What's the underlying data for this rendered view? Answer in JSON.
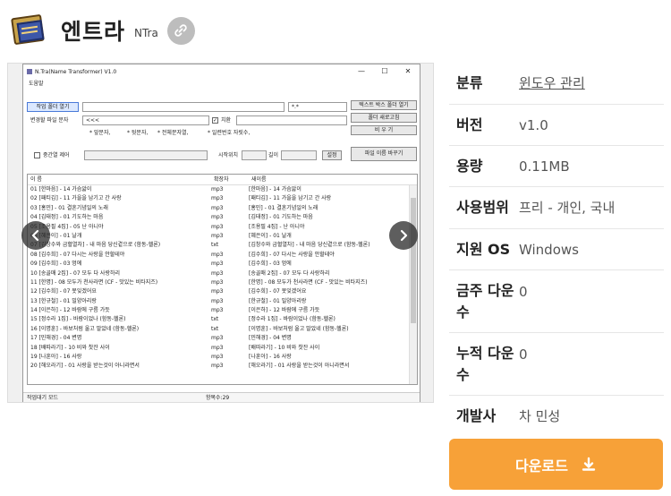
{
  "header": {
    "title": "엔트라",
    "subtitle": "NTra"
  },
  "screenshot": {
    "window_title": "N.Tra(Name Transformer) V1.0",
    "menu": "도움말",
    "buttons": {
      "open_folder": "작업 폴더 열기",
      "text_box_folder": "텍스트 박스 폴더 열기",
      "refresh_folder": "폴더 새로고침",
      "clear": "비 우 기",
      "rename": "파일 이름 바꾸기",
      "apply": "설정"
    },
    "filter_value": "*.*",
    "replace_label": "변경할 파일 문자",
    "replace_value": "<<<",
    "replace_check": "치환",
    "hints": {
      "h1": "* 앞문자,",
      "h2": "* 뒷문자,",
      "h3": "* 전체문자열,",
      "h4": "* 일련번호 자릿수,"
    },
    "middle_check": "중간열 제어",
    "start_pos": "시작위치",
    "length": "길이",
    "columns": [
      "이 름",
      "확장자",
      "새이름"
    ],
    "rows": [
      [
        "01 [한마음] - 14 가슴앓이",
        "mp3",
        "[한마음] - 14 가슴앓이"
      ],
      [
        "02 [패티김] - 11 가을을 남기고 간 사랑",
        "mp3",
        "[패티김] - 11 가을을 남기고 간 사랑"
      ],
      [
        "03 [홍민] - 01 결혼기념일의 노래",
        "mp3",
        "[홍민] - 01 결혼기념일의 노래"
      ],
      [
        "04 [김태정] - 01 기도하는 마음",
        "mp3",
        "[김태정] - 01 기도하는 마음"
      ],
      [
        "05 [조용필 4집] - 05 난 아니야",
        "mp3",
        "[조용필 4집] - 난 아니야"
      ],
      [
        "06 [혜은이] - 01 날개",
        "mp3",
        "[혜은이] - 01 날개"
      ],
      [
        "07 [김창수와 금혈열차] - 내 마음 당신곁으로 (함동-헬론)",
        "txt",
        "[김창수와 금혈열차] - 내 마음 당신곁으로 (함동-헬론)"
      ],
      [
        "08 [김수희] - 07 다시는 사랑을 안할테야",
        "mp3",
        "[김수희] - 07 다시는 사랑을 안할테야"
      ],
      [
        "09 [김수희] - 03 멍에",
        "mp3",
        "[김수희] - 03 멍에"
      ],
      [
        "10 [송골매 2집] - 07 모두 다 사랑하리",
        "mp3",
        "[송골매 2집] - 07 모두 다 사랑하리"
      ],
      [
        "11 [한명] - 08 모두가 천사라면 (CF - 맛있는 비타지즈)",
        "mp3",
        "[한명] - 08 모두가 천사라면 (CF - 맛있는 비타지즈)"
      ],
      [
        "12 [김수희] - 07 못잊겠어요",
        "mp3",
        "[김수희] - 07 못잊겠어요"
      ],
      [
        "13 [한규철] - 01 밀양아리랑",
        "mp3",
        "[한규철] - 01 밀양아리랑"
      ],
      [
        "14 [이은하] - 12 바람에 구름 가듯",
        "mp3",
        "[이은하] - 12 바람에 구름 가듯"
      ],
      [
        "15 [정수라 1집] - 바람이었나 (함동-헬론)",
        "txt",
        "[정수라 1집] - 바람이었나 (함동-헬론)"
      ],
      [
        "16 [이명훈] - 바보처럼 울고 말았네 (함동-헬론)",
        "txt",
        "[이명훈] - 바보처럼 울고 말았네 (함동-헬론)"
      ],
      [
        "17 [민해경] - 04 변명",
        "mp3",
        "[민해경] - 04 변명"
      ],
      [
        "18 [배따라기] - 10 비와 찻잔 사이",
        "mp3",
        "[배따라기] - 10 비와 찻잔 사이"
      ],
      [
        "19 [나훈아] - 16 사랑",
        "mp3",
        "[나훈아] - 16 사랑"
      ],
      [
        "20 [해오라기] - 01 사랑을 받는것이 아니라면서",
        "mp3",
        "[해오라기] - 01 사랑을 받는것이 아니라면서"
      ]
    ],
    "status_left": "작업대기 모드",
    "status_right": "항목수:29"
  },
  "info": {
    "category_label": "분류",
    "category_value": "윈도우 관리",
    "version_label": "버전",
    "version_value": "v1.0",
    "size_label": "용량",
    "size_value": "0.11MB",
    "license_label": "사용범위",
    "license_value": "프리 - 개인, 국내",
    "os_label": "지원 OS",
    "os_value": "Windows",
    "weekly_label": "금주 다운수",
    "weekly_value": "0",
    "total_label": "누적 다운수",
    "total_value": "0",
    "dev_label": "개발사",
    "dev_value": "차 민성"
  },
  "download_label": "다운로드",
  "colors": {
    "accent": "#f7a138",
    "link_btn": "#bdbdbd"
  }
}
